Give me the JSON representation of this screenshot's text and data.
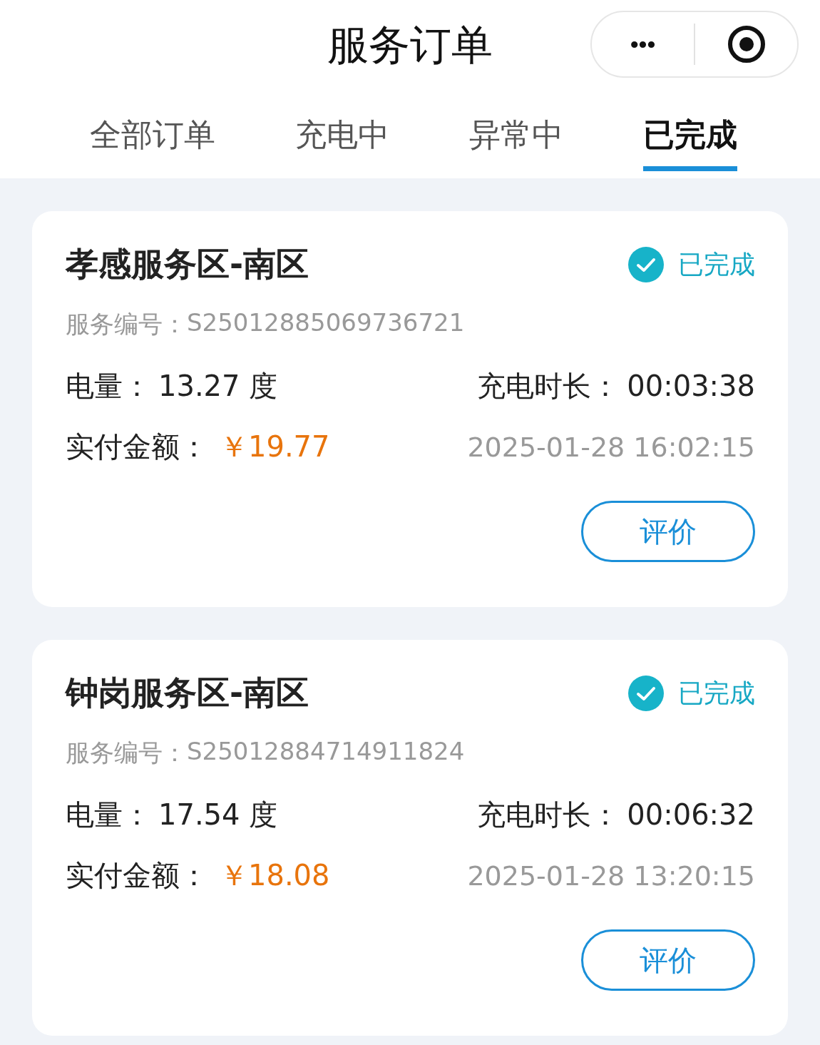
{
  "window": {
    "title": "服务订单",
    "menu_button": "•••"
  },
  "tabs": [
    {
      "label": "全部订单",
      "selected": false
    },
    {
      "label": "充电中",
      "selected": false
    },
    {
      "label": "异常中",
      "selected": false
    },
    {
      "label": "已完成",
      "selected": true
    }
  ],
  "orders": [
    {
      "station": "孝感服务区-南区",
      "status": "已完成",
      "serial_label": "服务编号：",
      "serial": "S25012885069736721",
      "energy_label": "电量：",
      "energy": "13.27 度",
      "duration_label": "充电时长：",
      "duration": "00:03:38",
      "paid_label": "实付金额：",
      "paid": "￥19.77",
      "time": "2025-01-28 16:02:15",
      "button": "评价"
    },
    {
      "station": "钟岗服务区-南区",
      "status": "已完成",
      "serial_label": "服务编号：",
      "serial": "S25012884714911824",
      "energy_label": "电量：",
      "energy": "17.54 度",
      "duration_label": "充电时长：",
      "duration": "00:06:32",
      "paid_label": "实付金额：",
      "paid": "￥18.08",
      "time": "2025-01-28 13:20:15",
      "button": "评价"
    }
  ]
}
